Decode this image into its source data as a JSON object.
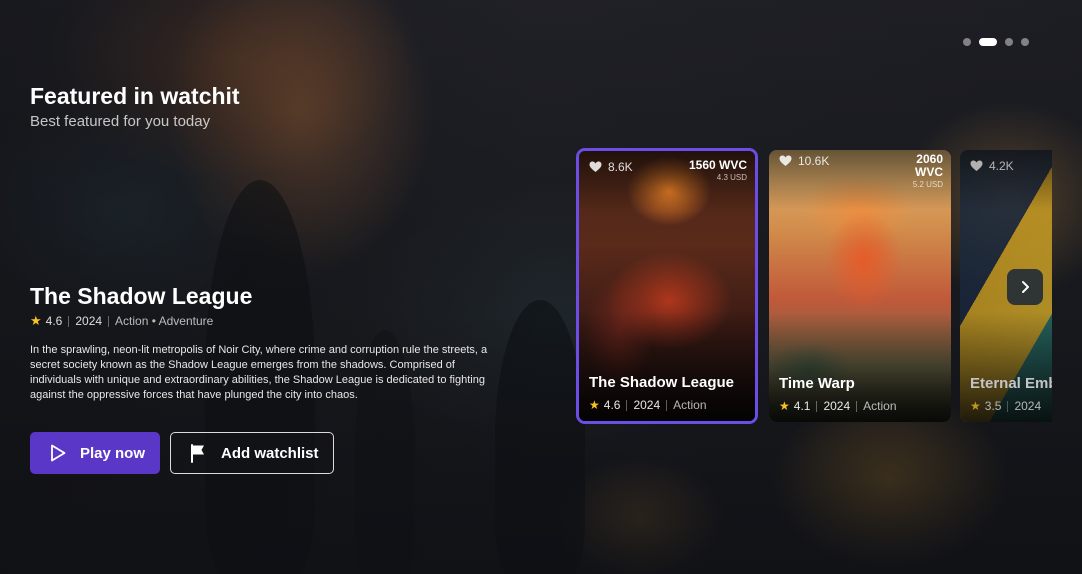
{
  "carousel": {
    "slide_count": 4,
    "active_index": 1
  },
  "featured": {
    "title": "Featured in watchit",
    "subtitle": "Best featured for you today"
  },
  "hero": {
    "title": "The Shadow League",
    "rating": "4.6",
    "year": "2024",
    "genres": "Action • Adventure",
    "description": "In the sprawling, neon-lit metropolis of Noir City, where crime and corruption rule the streets, a secret society known as the Shadow League emerges from the shadows. Comprised of individuals with unique and extraordinary abilities, the Shadow League is dedicated to fighting against the oppressive forces that have plunged the city into chaos.",
    "play_label": "Play now",
    "watchlist_label": "Add watchlist"
  },
  "cards": [
    {
      "likes": "8.6K",
      "price": "1560 WVC",
      "usd": "4.3 USD",
      "title": "The Shadow League",
      "rating": "4.6",
      "year": "2024",
      "genre": "Action",
      "selected": true
    },
    {
      "likes": "10.6K",
      "price": "2060 WVC",
      "usd": "5.2 USD",
      "title": "Time Warp",
      "rating": "4.1",
      "year": "2024",
      "genre": "Action",
      "selected": false
    },
    {
      "likes": "4.2K",
      "price": "",
      "usd": "",
      "title": "Eternal Emb",
      "rating": "3.5",
      "year": "2024",
      "genre": "",
      "selected": false
    }
  ],
  "colors": {
    "accent": "#5a37c7",
    "selected_border": "#6b4ee6",
    "star": "#f7c325"
  },
  "icons": {
    "play": "play-icon",
    "watchlist": "flag-icon",
    "like": "heart-icon",
    "rating": "star-icon",
    "next": "chevron-right-icon"
  }
}
